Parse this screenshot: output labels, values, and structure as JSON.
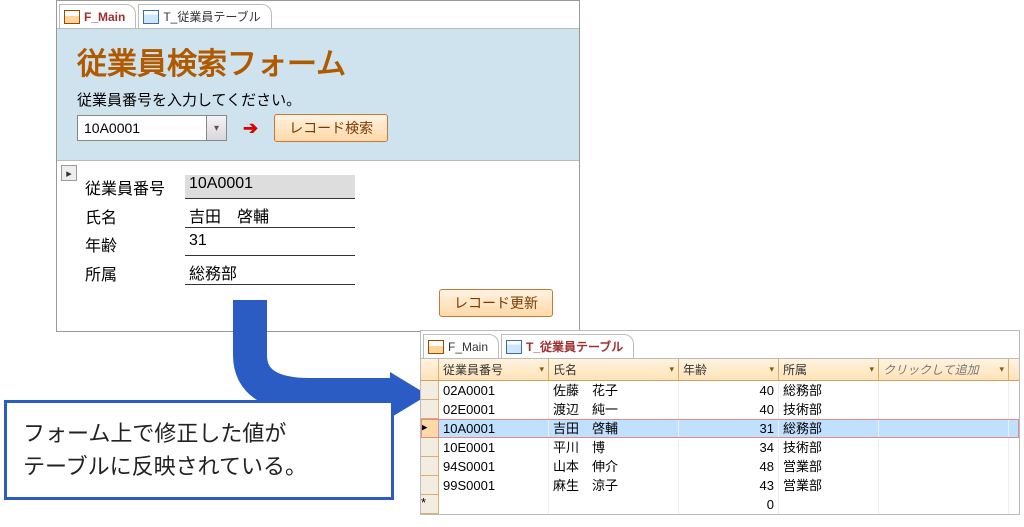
{
  "form_window": {
    "tabs": [
      {
        "label": "F_Main",
        "active": true,
        "icon": "form-icon"
      },
      {
        "label": "T_従業員テーブル",
        "active": false,
        "icon": "table-icon"
      }
    ],
    "title": "従業員検索フォーム",
    "prompt": "従業員番号を入力してください。",
    "combo_value": "10A0001",
    "search_button": "レコード検索",
    "fields": {
      "emp_no": {
        "label": "従業員番号",
        "value": "10A0001"
      },
      "name": {
        "label": "氏名",
        "value": "吉田　啓輔"
      },
      "age": {
        "label": "年齢",
        "value": "31"
      },
      "dept": {
        "label": "所属",
        "value": "総務部"
      }
    },
    "update_button": "レコード更新"
  },
  "caption": {
    "line1": "フォーム上で修正した値が",
    "line2": "テーブルに反映されている。"
  },
  "table_window": {
    "tabs": [
      {
        "label": "F_Main",
        "active": false,
        "icon": "form-icon"
      },
      {
        "label": "T_従業員テーブル",
        "active": true,
        "icon": "table-icon"
      }
    ],
    "columns": {
      "emp_no": "従業員番号",
      "name": "氏名",
      "age": "年齢",
      "dept": "所属",
      "add": "クリックして追加"
    },
    "highlight_emp_no": "10A0001",
    "rows": [
      {
        "emp_no": "02A0001",
        "name": "佐藤　花子",
        "age": "40",
        "dept": "総務部"
      },
      {
        "emp_no": "02E0001",
        "name": "渡辺　純一",
        "age": "40",
        "dept": "技術部"
      },
      {
        "emp_no": "10A0001",
        "name": "吉田　啓輔",
        "age": "31",
        "dept": "総務部"
      },
      {
        "emp_no": "10E0001",
        "name": "平川　博",
        "age": "34",
        "dept": "技術部"
      },
      {
        "emp_no": "94S0001",
        "name": "山本　伸介",
        "age": "48",
        "dept": "営業部"
      },
      {
        "emp_no": "99S0001",
        "name": "麻生　涼子",
        "age": "43",
        "dept": "営業部"
      }
    ],
    "new_row_marker": "*",
    "new_row_age": "0"
  }
}
